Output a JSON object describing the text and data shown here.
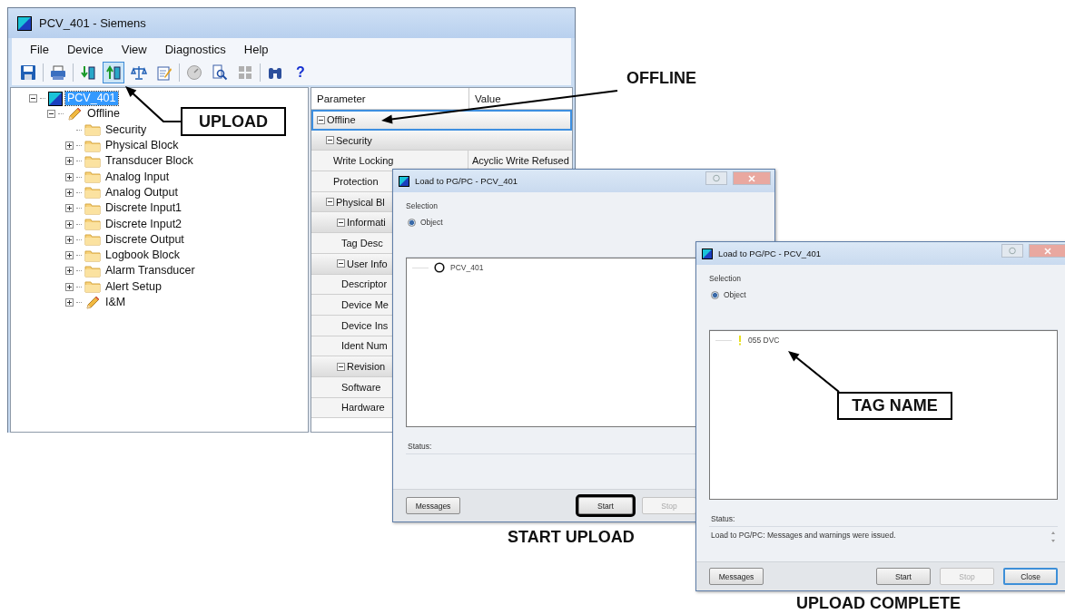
{
  "main_window": {
    "title": "PCV_401 - Siemens",
    "menu": [
      "File",
      "Device",
      "View",
      "Diagnostics",
      "Help"
    ],
    "toolbar": [
      {
        "selected": false
      },
      {
        "selected": false
      },
      {
        "selected": false
      },
      {
        "selected": true
      },
      {
        "selected": false
      },
      {
        "selected": false
      },
      {
        "selected": false
      },
      {
        "selected": false
      },
      {
        "selected": false
      },
      {
        "selected": false
      },
      {
        "selected": false,
        "label": "?"
      }
    ],
    "tree": [
      {
        "label": "PCV_401",
        "kind": "device",
        "selected": true,
        "expanded": true,
        "children": [
          {
            "label": "Offline",
            "kind": "pencil",
            "selected": false,
            "expanded": true,
            "children": [
              {
                "label": "Security",
                "kind": "folder",
                "selected": false
              },
              {
                "label": "Physical Block",
                "kind": "folder",
                "selected": false,
                "expanded": false
              },
              {
                "label": "Transducer Block",
                "kind": "folder",
                "selected": false,
                "expanded": false
              },
              {
                "label": "Analog Input",
                "kind": "folder",
                "selected": false,
                "expanded": false
              },
              {
                "label": "Analog Output",
                "kind": "folder",
                "selected": false,
                "expanded": false
              },
              {
                "label": "Discrete Input1",
                "kind": "folder",
                "selected": false,
                "expanded": false
              },
              {
                "label": "Discrete Input2",
                "kind": "folder",
                "selected": false,
                "expanded": false
              },
              {
                "label": "Discrete Output",
                "kind": "folder",
                "selected": false,
                "expanded": false
              },
              {
                "label": "Logbook Block",
                "kind": "folder",
                "selected": false,
                "expanded": false
              },
              {
                "label": "Alarm Transducer",
                "kind": "folder",
                "selected": false,
                "expanded": false
              },
              {
                "label": "Alert Setup",
                "kind": "folder",
                "selected": false,
                "expanded": false
              },
              {
                "label": "I&M",
                "kind": "pencil",
                "selected": false,
                "expanded": false
              }
            ]
          }
        ]
      }
    ],
    "grid": {
      "columns": [
        "Parameter",
        "Value"
      ],
      "rows": [
        {
          "kind": "group",
          "label": "Offline",
          "expanded": true,
          "selected": true,
          "children": [
            {
              "kind": "group",
              "label": "Security",
              "expanded": true,
              "selected": false,
              "children": [
                {
                  "kind": "param",
                  "label": "Write Locking",
                  "value": "Acyclic Write Refused",
                  "selected": false
                },
                {
                  "kind": "param",
                  "label": "Protection",
                  "selected": false
                }
              ]
            },
            {
              "kind": "group",
              "label": "Physical Bl",
              "expanded": true,
              "selected": false,
              "children": [
                {
                  "kind": "group",
                  "label": "Informati",
                  "expanded": true,
                  "selected": false,
                  "children": [
                    {
                      "kind": "param",
                      "label": "Tag Desc",
                      "selected": false
                    }
                  ]
                },
                {
                  "kind": "group",
                  "label": "User Info",
                  "expanded": true,
                  "selected": false,
                  "children": [
                    {
                      "kind": "param",
                      "label": "Descriptor",
                      "selected": false
                    },
                    {
                      "kind": "param",
                      "label": "Device Me",
                      "selected": false
                    },
                    {
                      "kind": "param",
                      "label": "Device Ins",
                      "selected": false
                    },
                    {
                      "kind": "param",
                      "label": "Ident Num",
                      "selected": false
                    }
                  ]
                },
                {
                  "kind": "group",
                  "label": "Revision",
                  "expanded": true,
                  "selected": false,
                  "children": [
                    {
                      "kind": "param",
                      "label": "Software",
                      "selected": false
                    },
                    {
                      "kind": "param",
                      "label": "Hardware",
                      "selected": false
                    }
                  ]
                }
              ]
            }
          ]
        }
      ]
    }
  },
  "dialogs": [
    {
      "title": "Load to PG/PC - PCV_401",
      "selection_label": "Selection",
      "options": [
        {
          "label": "Object",
          "selected": true
        }
      ],
      "items": [
        {
          "label": "PCV_401",
          "kind": "circle"
        }
      ],
      "status_label": "Status:",
      "buttons": [
        {
          "label": "Messages",
          "disabled": false,
          "focused": false,
          "highlighted": false
        },
        {
          "label": "Start",
          "disabled": false,
          "focused": false,
          "highlighted": true
        },
        {
          "label": "Stop",
          "disabled": true,
          "focused": false,
          "highlighted": false
        }
      ]
    },
    {
      "title": "Load to PG/PC - PCV_401",
      "selection_label": "Selection",
      "options": [
        {
          "label": "Object",
          "selected": true
        }
      ],
      "items": [
        {
          "label": "055 DVC",
          "kind": "warning"
        }
      ],
      "status_label": "Status:",
      "status_text": "Load to PG/PC: Messages and warnings were issued.",
      "buttons": [
        {
          "label": "Messages",
          "disabled": false,
          "focused": false,
          "highlighted": false
        },
        {
          "label": "Start",
          "disabled": false,
          "focused": false,
          "highlighted": false
        },
        {
          "label": "Stop",
          "disabled": true,
          "focused": false,
          "highlighted": false
        },
        {
          "label": "Close",
          "disabled": false,
          "focused": true,
          "highlighted": false
        }
      ]
    }
  ],
  "callouts": [
    {
      "label": "UPLOAD",
      "kind": "boxed"
    },
    {
      "label": "OFFLINE",
      "kind": "plain"
    },
    {
      "label": "TAG NAME",
      "kind": "boxed"
    },
    {
      "label": "START UPLOAD",
      "kind": "plain"
    },
    {
      "label": "UPLOAD COMPLETE",
      "kind": "plain"
    }
  ]
}
